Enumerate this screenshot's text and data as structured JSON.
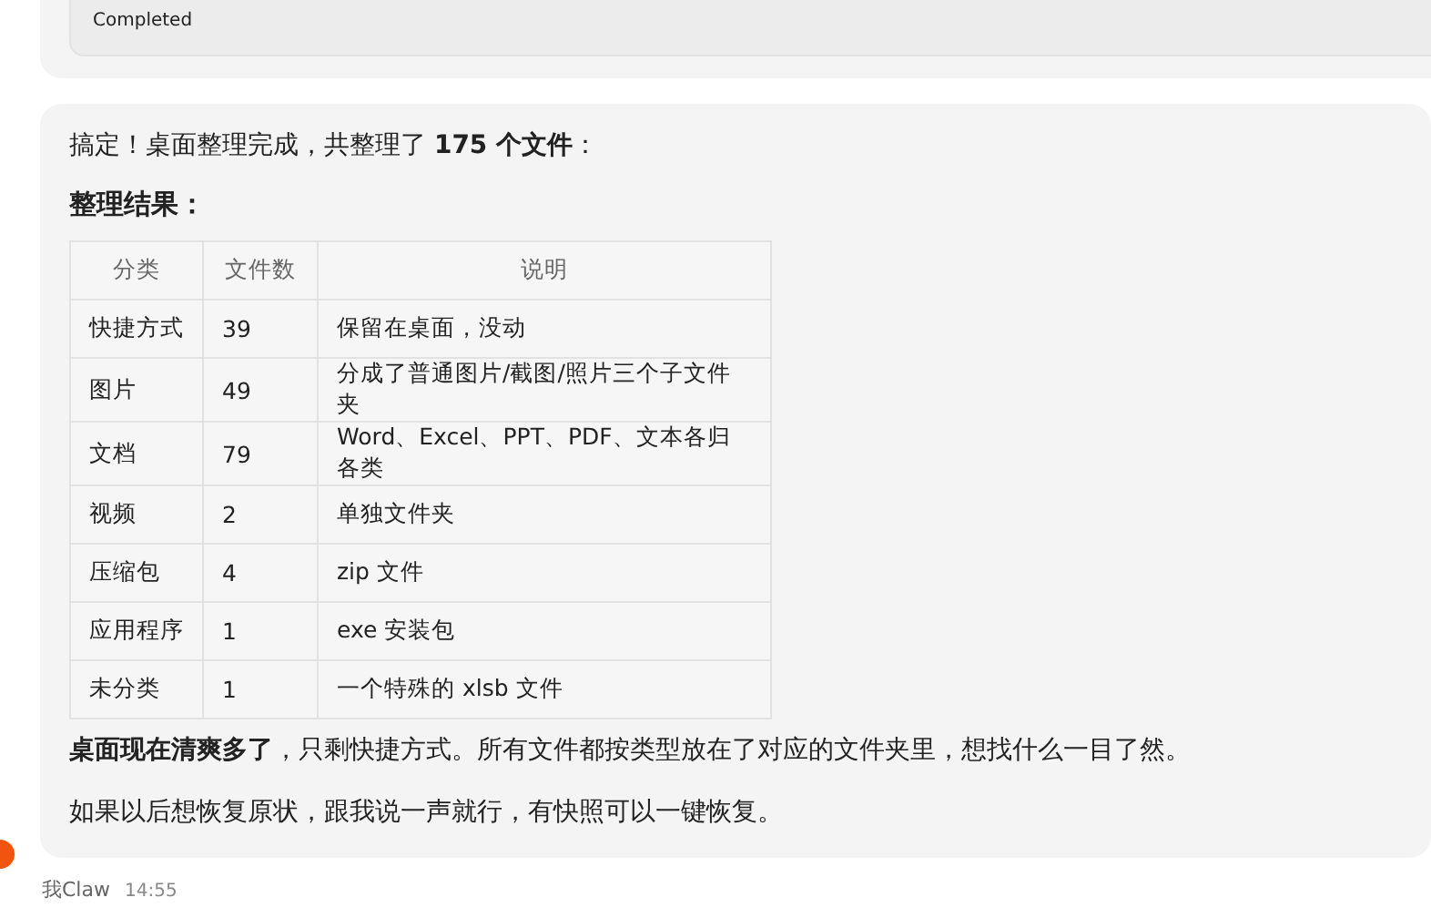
{
  "previous_message": {
    "status": "Completed"
  },
  "message": {
    "intro": "搞定！桌面整理完成，共整理了 **175 个文件**：",
    "heading": "整理结果：",
    "table": {
      "columns": [
        "分类",
        "文件数",
        "说明"
      ],
      "rows": [
        [
          "快捷方式",
          "39",
          "保留在桌面，没动"
        ],
        [
          "图片",
          "49",
          "分成了普通图片/截图/照片三个子文件夹"
        ],
        [
          "文档",
          "79",
          "Word、Excel、PPT、PDF、文本各归各类"
        ],
        [
          "视频",
          "2",
          "单独文件夹"
        ],
        [
          "压缩包",
          "4",
          "zip 文件"
        ],
        [
          "应用程序",
          "1",
          "exe 安装包"
        ],
        [
          "未分类",
          "1",
          "一个特殊的 xlsb 文件"
        ]
      ]
    },
    "paragraphs": [
      "**桌面现在清爽多了**，只剩快捷方式。所有文件都按类型放在了对应的文件夹里，想找什么一目了然。",
      "如果以后想恢复原状，跟我说一声就行，有快照可以一键恢复。"
    ]
  },
  "footer": {
    "sender": "我Claw",
    "time": "14:55"
  }
}
